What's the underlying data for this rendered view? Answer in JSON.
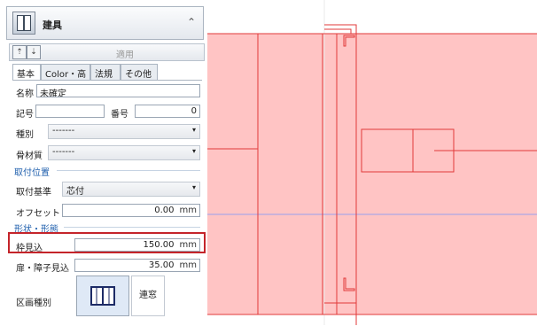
{
  "panel": {
    "title": "建具",
    "collapse_icon": "chevron-up-double-icon",
    "toolbar": {
      "apply_label": "適用",
      "icons": [
        "upload-icon",
        "download-icon"
      ]
    },
    "tabs": [
      "基本",
      "Color・高",
      "法規",
      "その他"
    ],
    "active_tab": "基本",
    "fields": {
      "name_label": "名称",
      "name_value": "未確定",
      "symbol_label": "記号",
      "symbol_value": "",
      "number_label": "番号",
      "number_value": "0",
      "type_label": "種別",
      "type_value": "-------",
      "frame_label": "骨材質",
      "frame_value": "-------"
    },
    "mount_section": {
      "title": "取付位置",
      "base_label": "取付基準",
      "base_value": "芯付",
      "offset_label": "オフセット",
      "offset_value": "0.00",
      "offset_unit": "mm"
    },
    "shape_section": {
      "title": "形状・形態",
      "frame_depth_label": "枠見込",
      "frame_depth_value": "150.00",
      "frame_depth_unit": "mm",
      "door_depth_label": "扉・障子見込",
      "door_depth_value": "35.00",
      "door_depth_unit": "mm",
      "division_label": "区画種別",
      "division_button_label": "連窓"
    }
  },
  "colors": {
    "accent": "#1f5fad",
    "highlight": "#c4242a",
    "fill": "#ffc4c4",
    "line": "#e23a3a"
  }
}
